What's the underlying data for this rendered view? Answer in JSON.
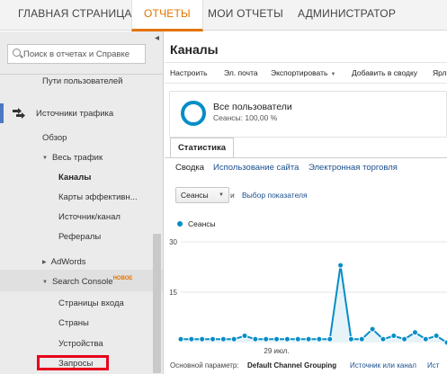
{
  "topnav": {
    "home": "ГЛАВНАЯ СТРАНИЦА",
    "reports": "ОТЧЕТЫ",
    "my_reports": "МОИ ОТЧЕТЫ",
    "admin": "АДМИНИСТРАТОР"
  },
  "sidebar": {
    "search_placeholder": "Поиск в отчетах и Справке",
    "user_paths": "Пути пользователей",
    "traffic_sources": "Источники трафика",
    "overview": "Обзор",
    "all_traffic": "Весь трафик",
    "channels": "Каналы",
    "effectiveness_maps": "Карты эффективн...",
    "source_medium": "Источник/канал",
    "referrals": "Рефералы",
    "adwords": "AdWords",
    "search_console": "Search Console",
    "new_badge": "НОВОЕ",
    "landing_pages": "Страницы входа",
    "countries": "Страны",
    "devices": "Устройства",
    "queries": "Запросы"
  },
  "main": {
    "title": "Каналы",
    "toolbar": {
      "customize": "Настроить",
      "email": "Эл. почта",
      "export": "Экспортировать",
      "add_to_dashboard": "Добавить в сводку",
      "more": "Ярл"
    },
    "segment": {
      "name": "Все пользователи",
      "sub": "Сеансы: 100,00 %"
    },
    "stat_tab": "Статистика",
    "subtabs": {
      "summary": "Сводка",
      "site_usage": "Использование сайта",
      "ecommerce": "Электронная торговля"
    },
    "metric_select": "Сеансы",
    "and_label": "и",
    "pick_metric": "Выбор показателя",
    "bottom": {
      "primary_label": "Основной параметр:",
      "primary_value": "Default Channel Grouping",
      "link1": "Источник или канал",
      "link2": "Ист"
    }
  },
  "chart_data": {
    "type": "area",
    "series": [
      {
        "name": "Сеансы",
        "values": [
          1,
          1,
          1,
          1,
          1,
          1,
          2,
          1,
          1,
          1,
          1,
          1,
          1,
          1,
          1,
          23,
          1,
          1,
          4,
          1,
          2,
          1,
          3,
          1,
          2,
          0
        ]
      }
    ],
    "y_ticks": [
      "30",
      "15"
    ],
    "x_tick_labels": [
      {
        "index": 9,
        "label": "29 июл."
      }
    ],
    "ylim": [
      0,
      30
    ],
    "color": "#058dc7"
  },
  "colors": {
    "accent": "#e37400",
    "link": "#1a4f8e",
    "series": "#058dc7",
    "highlight": "#e8001c"
  }
}
